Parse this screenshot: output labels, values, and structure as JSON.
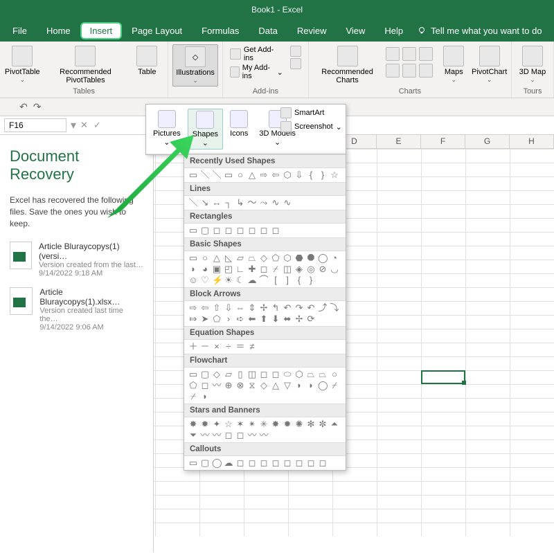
{
  "app": {
    "title": "Book1 - Excel"
  },
  "menu": {
    "tabs": [
      "File",
      "Home",
      "Insert",
      "Page Layout",
      "Formulas",
      "Data",
      "Review",
      "View",
      "Help"
    ],
    "active": "Insert",
    "tell_me": "Tell me what you want to do"
  },
  "ribbon": {
    "tables": {
      "label": "Tables",
      "pivottable": "PivotTable",
      "recommended": "Recommended PivotTables",
      "table": "Table"
    },
    "illustrations": {
      "label": "Illustrations",
      "btn": "Illustrations"
    },
    "addins": {
      "label": "Add-ins",
      "get": "Get Add-ins",
      "my": "My Add-ins"
    },
    "charts": {
      "label": "Charts",
      "recommended": "Recommended Charts",
      "maps": "Maps",
      "pivotchart": "PivotChart"
    },
    "tours": {
      "label": "Tours",
      "map3d": "3D Map"
    }
  },
  "illus_toolbar": {
    "pictures": "Pictures",
    "shapes": "Shapes",
    "icons": "Icons",
    "models": "3D Models",
    "smartart": "SmartArt",
    "screenshot": "Screenshot"
  },
  "shapes": {
    "sections": [
      "Recently Used Shapes",
      "Lines",
      "Rectangles",
      "Basic Shapes",
      "Block Arrows",
      "Equation Shapes",
      "Flowchart",
      "Stars and Banners",
      "Callouts"
    ]
  },
  "qat": {
    "undo": "↶",
    "redo": "↷"
  },
  "namebox": {
    "ref": "F16"
  },
  "recovery": {
    "title": "Document Recovery",
    "intro": "Excel has recovered the following files. Save the ones you wish to keep.",
    "files": [
      {
        "name": "Article Bluraycopys(1) (versi…",
        "desc": "Version created from the last…",
        "date": "9/14/2022 9:18 AM"
      },
      {
        "name": "Article Bluraycopys(1).xlsx…",
        "desc": "Version created last time the…",
        "date": "9/14/2022 9:06 AM"
      }
    ]
  },
  "grid": {
    "columns": [
      "D",
      "E",
      "F",
      "G",
      "H"
    ],
    "selected": "F16"
  }
}
